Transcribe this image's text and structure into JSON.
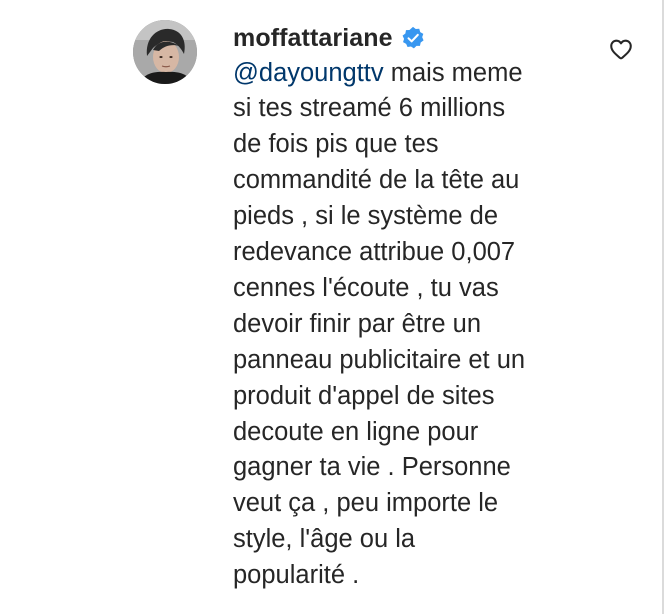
{
  "comment": {
    "username": "moffattariane",
    "mention": "@dayoungttv",
    "text_lines": [
      " mais meme",
      "si tes streamé 6 millions",
      "de fois pis que tes",
      "commandité de la tête au",
      "pieds , si le système de",
      "redevance attribue 0,007",
      "cennes l'écoute , tu vas",
      "devoir finir par être un",
      "panneau publicitaire et un",
      "produit d'appel de sites",
      "decoute en ligne pour",
      "gagner ta vie . Personne",
      "veut ça , peu importe le",
      "style, l'âge ou la",
      "popularité ."
    ]
  },
  "icons": {
    "verified": "verified-badge-icon",
    "like": "heart-outline-icon",
    "avatar": "profile-photo"
  },
  "colors": {
    "text": "#262626",
    "mention": "#00376b",
    "verified_badge": "#3897f0"
  }
}
